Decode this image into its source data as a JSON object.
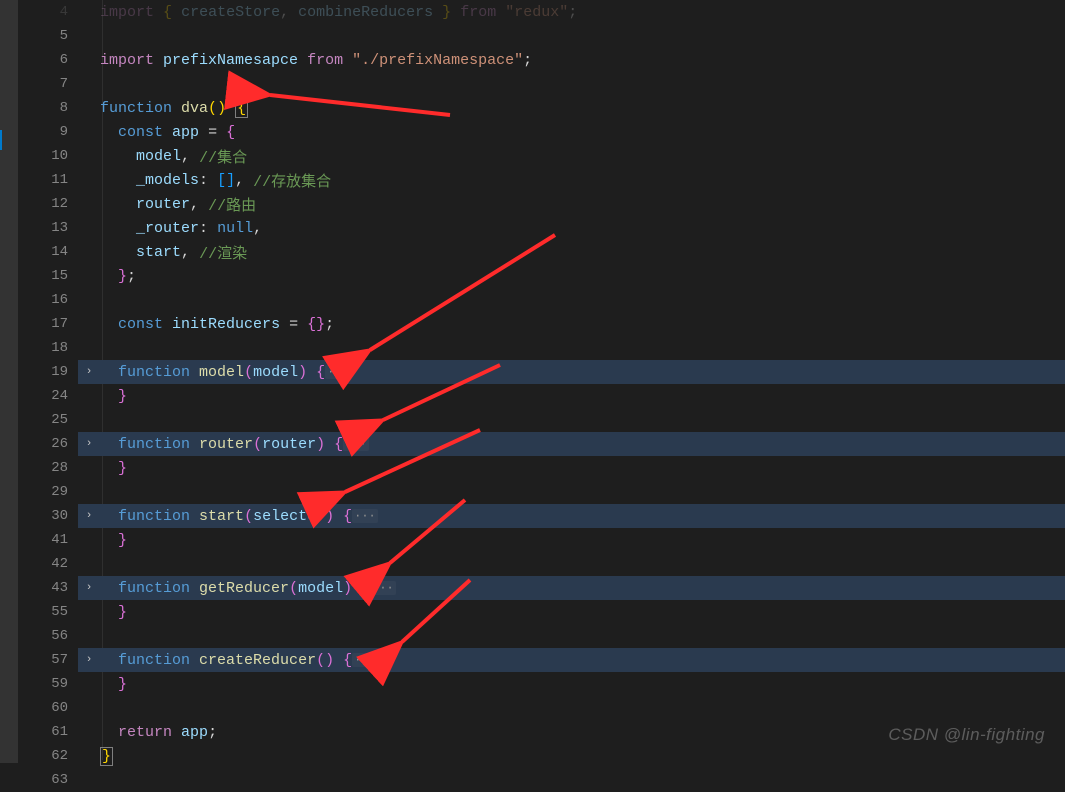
{
  "watermark": "CSDN @lin-fighting",
  "editor": {
    "lines": [
      {
        "num": 4,
        "html": [
          {
            "c": "keyword",
            "t": "import"
          },
          {
            "t": " "
          },
          {
            "c": "brace",
            "t": "{"
          },
          {
            "t": " "
          },
          {
            "c": "var",
            "t": "createStore"
          },
          {
            "c": "punct",
            "t": ","
          },
          {
            "t": " "
          },
          {
            "c": "var",
            "t": "combineReducers"
          },
          {
            "t": " "
          },
          {
            "c": "brace",
            "t": "}"
          },
          {
            "t": " "
          },
          {
            "c": "keyword",
            "t": "from"
          },
          {
            "t": " "
          },
          {
            "c": "string",
            "t": "\"redux\""
          },
          {
            "c": "punct",
            "t": ";"
          }
        ]
      },
      {
        "num": 5,
        "html": []
      },
      {
        "num": 6,
        "html": [
          {
            "c": "keyword",
            "t": "import"
          },
          {
            "t": " "
          },
          {
            "c": "var",
            "t": "prefixNamesapce"
          },
          {
            "t": " "
          },
          {
            "c": "keyword",
            "t": "from"
          },
          {
            "t": " "
          },
          {
            "c": "string",
            "t": "\"./prefixNamespace\""
          },
          {
            "c": "punct",
            "t": ";"
          }
        ]
      },
      {
        "num": 7,
        "html": []
      },
      {
        "num": 8,
        "html": [
          {
            "c": "storage",
            "t": "function"
          },
          {
            "t": " "
          },
          {
            "c": "func",
            "t": "dva"
          },
          {
            "c": "brace",
            "t": "("
          },
          {
            "c": "brace",
            "t": ")"
          },
          {
            "t": " "
          },
          {
            "c": "brace",
            "t": "{",
            "box": true
          }
        ]
      },
      {
        "num": 9,
        "html": [
          {
            "t": "  "
          },
          {
            "c": "storage",
            "t": "const"
          },
          {
            "t": " "
          },
          {
            "c": "var",
            "t": "app"
          },
          {
            "t": " "
          },
          {
            "c": "punct",
            "t": "="
          },
          {
            "t": " "
          },
          {
            "c": "brace2",
            "t": "{"
          }
        ]
      },
      {
        "num": 10,
        "html": [
          {
            "t": "    "
          },
          {
            "c": "var",
            "t": "model"
          },
          {
            "c": "punct",
            "t": ","
          },
          {
            "t": " "
          },
          {
            "c": "comment",
            "t": "//集合"
          }
        ]
      },
      {
        "num": 11,
        "html": [
          {
            "t": "    "
          },
          {
            "c": "var",
            "t": "_models"
          },
          {
            "c": "punct",
            "t": ":"
          },
          {
            "t": " "
          },
          {
            "c": "paren",
            "t": "["
          },
          {
            "c": "paren",
            "t": "]"
          },
          {
            "c": "punct",
            "t": ","
          },
          {
            "t": " "
          },
          {
            "c": "comment",
            "t": "//存放集合"
          }
        ]
      },
      {
        "num": 12,
        "html": [
          {
            "t": "    "
          },
          {
            "c": "var",
            "t": "router"
          },
          {
            "c": "punct",
            "t": ","
          },
          {
            "t": " "
          },
          {
            "c": "comment",
            "t": "//路由"
          }
        ]
      },
      {
        "num": 13,
        "html": [
          {
            "t": "    "
          },
          {
            "c": "var",
            "t": "_router"
          },
          {
            "c": "punct",
            "t": ":"
          },
          {
            "t": " "
          },
          {
            "c": "null",
            "t": "null"
          },
          {
            "c": "punct",
            "t": ","
          }
        ]
      },
      {
        "num": 14,
        "html": [
          {
            "t": "    "
          },
          {
            "c": "var",
            "t": "start"
          },
          {
            "c": "punct",
            "t": ","
          },
          {
            "t": " "
          },
          {
            "c": "comment",
            "t": "//渲染"
          }
        ]
      },
      {
        "num": 15,
        "html": [
          {
            "t": "  "
          },
          {
            "c": "brace2",
            "t": "}"
          },
          {
            "c": "punct",
            "t": ";"
          }
        ]
      },
      {
        "num": 16,
        "html": []
      },
      {
        "num": 17,
        "html": [
          {
            "t": "  "
          },
          {
            "c": "storage",
            "t": "const"
          },
          {
            "t": " "
          },
          {
            "c": "var",
            "t": "initReducers"
          },
          {
            "t": " "
          },
          {
            "c": "punct",
            "t": "="
          },
          {
            "t": " "
          },
          {
            "c": "brace2",
            "t": "{"
          },
          {
            "c": "brace2",
            "t": "}"
          },
          {
            "c": "punct",
            "t": ";"
          }
        ]
      },
      {
        "num": 18,
        "html": []
      },
      {
        "num": 19,
        "fold": true,
        "hl": true,
        "html": [
          {
            "t": "  "
          },
          {
            "c": "storage",
            "t": "function"
          },
          {
            "t": " "
          },
          {
            "c": "func",
            "t": "model"
          },
          {
            "c": "brace2",
            "t": "("
          },
          {
            "c": "var",
            "t": "model"
          },
          {
            "c": "brace2",
            "t": ")"
          },
          {
            "t": " "
          },
          {
            "c": "brace2",
            "t": "{"
          },
          {
            "c": "dots",
            "t": "···"
          }
        ]
      },
      {
        "num": 24,
        "html": [
          {
            "t": "  "
          },
          {
            "c": "brace2",
            "t": "}"
          }
        ]
      },
      {
        "num": 25,
        "html": []
      },
      {
        "num": 26,
        "fold": true,
        "hl": true,
        "html": [
          {
            "t": "  "
          },
          {
            "c": "storage",
            "t": "function"
          },
          {
            "t": " "
          },
          {
            "c": "func",
            "t": "router"
          },
          {
            "c": "brace2",
            "t": "("
          },
          {
            "c": "var",
            "t": "router"
          },
          {
            "c": "brace2",
            "t": ")"
          },
          {
            "t": " "
          },
          {
            "c": "brace2",
            "t": "{"
          },
          {
            "c": "dots",
            "t": "···"
          }
        ]
      },
      {
        "num": 28,
        "html": [
          {
            "t": "  "
          },
          {
            "c": "brace2",
            "t": "}"
          }
        ]
      },
      {
        "num": 29,
        "html": []
      },
      {
        "num": 30,
        "fold": true,
        "hl": true,
        "html": [
          {
            "t": "  "
          },
          {
            "c": "storage",
            "t": "function"
          },
          {
            "t": " "
          },
          {
            "c": "func",
            "t": "start"
          },
          {
            "c": "brace2",
            "t": "("
          },
          {
            "c": "var",
            "t": "selector"
          },
          {
            "c": "brace2",
            "t": ")"
          },
          {
            "t": " "
          },
          {
            "c": "brace2",
            "t": "{"
          },
          {
            "c": "dots",
            "t": "···"
          }
        ]
      },
      {
        "num": 41,
        "html": [
          {
            "t": "  "
          },
          {
            "c": "brace2",
            "t": "}"
          }
        ]
      },
      {
        "num": 42,
        "html": []
      },
      {
        "num": 43,
        "fold": true,
        "hl": true,
        "html": [
          {
            "t": "  "
          },
          {
            "c": "storage",
            "t": "function"
          },
          {
            "t": " "
          },
          {
            "c": "func",
            "t": "getReducer"
          },
          {
            "c": "brace2",
            "t": "("
          },
          {
            "c": "var",
            "t": "model"
          },
          {
            "c": "brace2",
            "t": ")"
          },
          {
            "t": " "
          },
          {
            "c": "brace2",
            "t": "{"
          },
          {
            "c": "dots",
            "t": "···"
          }
        ]
      },
      {
        "num": 55,
        "html": [
          {
            "t": "  "
          },
          {
            "c": "brace2",
            "t": "}"
          }
        ]
      },
      {
        "num": 56,
        "html": []
      },
      {
        "num": 57,
        "fold": true,
        "hl": true,
        "html": [
          {
            "t": "  "
          },
          {
            "c": "storage",
            "t": "function"
          },
          {
            "t": " "
          },
          {
            "c": "func",
            "t": "createReducer"
          },
          {
            "c": "brace2",
            "t": "("
          },
          {
            "c": "brace2",
            "t": ")"
          },
          {
            "t": " "
          },
          {
            "c": "brace2",
            "t": "{"
          },
          {
            "c": "dots",
            "t": "···"
          }
        ]
      },
      {
        "num": 59,
        "html": [
          {
            "t": "  "
          },
          {
            "c": "brace2",
            "t": "}"
          }
        ]
      },
      {
        "num": 60,
        "html": []
      },
      {
        "num": 61,
        "html": [
          {
            "t": "  "
          },
          {
            "c": "keyword",
            "t": "return"
          },
          {
            "t": " "
          },
          {
            "c": "var",
            "t": "app"
          },
          {
            "c": "punct",
            "t": ";"
          }
        ]
      },
      {
        "num": 62,
        "html": [
          {
            "c": "brace",
            "t": "}",
            "box": true
          }
        ]
      },
      {
        "num": 63,
        "html": []
      }
    ]
  }
}
